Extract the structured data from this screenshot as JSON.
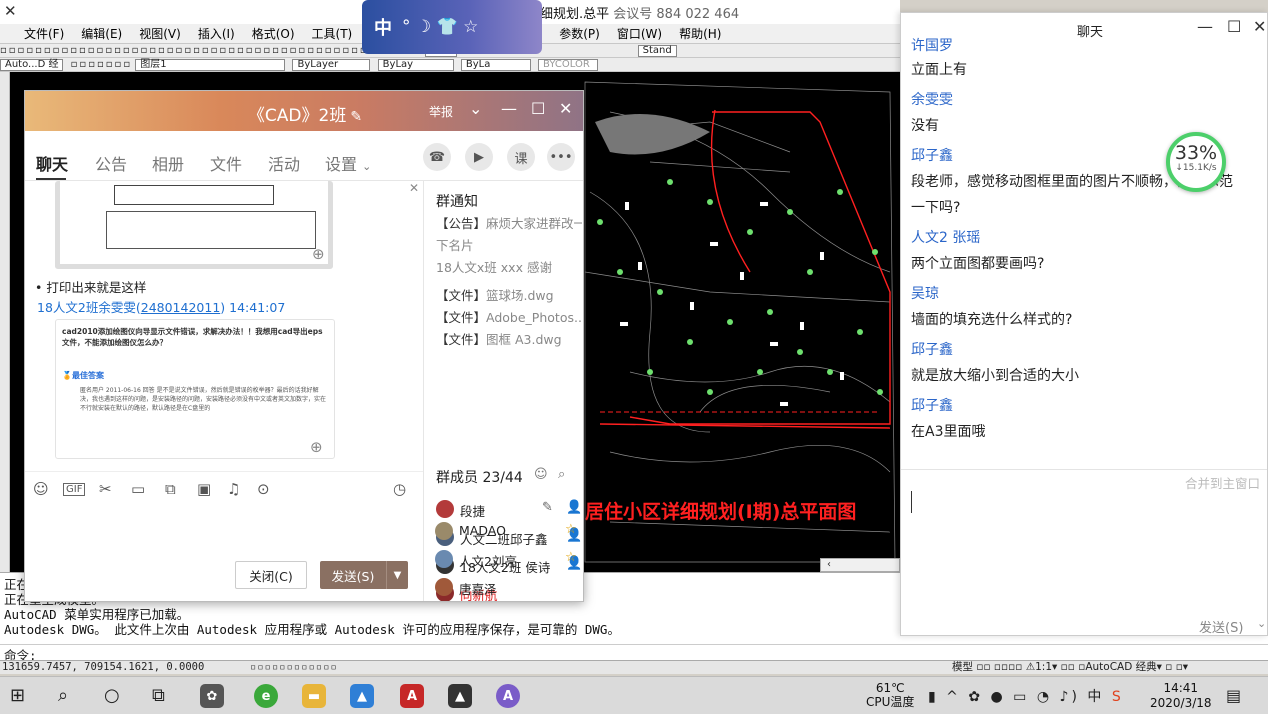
{
  "acad": {
    "title_text": "细规划.总平",
    "meeting_text": "会议号 884 022 464",
    "menu": [
      "文件(F)",
      "编辑(E)",
      "视图(V)",
      "插入(I)",
      "格式(O)",
      "工具(T)"
    ],
    "menu_right": [
      "参数(P)",
      "窗口(W)",
      "帮助(H)"
    ],
    "toolbar1_text": "Stan",
    "toolbar1_style": "Stand",
    "toolbar2_font": "Auto...D 经",
    "toolbar2_layer": "图层1",
    "toolbar2_bylayer": "ByLayer",
    "toolbar2_bylay1": "ByLay",
    "toolbar2_bylay2": "ByLa",
    "toolbar2_bycolor": "BYCOLOR",
    "plan_title": "居住小区详细规划(I期)总平面图",
    "command_lines": [
      "正在",
      "正在重生成模型。",
      "AutoCAD 菜单实用程序已加载。",
      "Autodesk DWG。  此文件上次由 Autodesk 应用程序或 Autodesk 许可的应用程序保存，是可靠的 DWG。"
    ],
    "command_prompt": "命令:",
    "coords": "131659.7457, 709154.1621, 0.0000",
    "status_right": "模型  ▫▫   ▫▫▫▫   ⚠1:1▾ ▫▫ ▫AutoCAD 经典▾ ▫ ▫▾"
  },
  "ime": {
    "lang": "中",
    "symbols": "° ☽ 👕 ☆"
  },
  "group_window": {
    "title": "《CAD》2班",
    "report": "举报",
    "tabs": [
      "聊天",
      "公告",
      "相册",
      "文件",
      "活动",
      "设置"
    ],
    "round_buttons": [
      "☎",
      "▶",
      "课",
      "•••"
    ],
    "messages": {
      "text1": "• 打印出来就是这样",
      "sender2_name": "18人文2班余雯雯",
      "sender2_qq": "2480142011",
      "sender2_time": "14:41:07",
      "img2_question": "cad2010添加绘图仪向导显示文件错误，求解决办法！！我想用cad导出eps文件，不能添加绘图仪怎么办？",
      "img2_best": "最佳答案",
      "img2_answer": "匿名用户 2011-06-16 回答 是不是说文件错误，然后就是错误的枚举器？最后的话我好解决，我也遇到这样的问题，是安装路径的问题，安装路径必须没有中文或者英文加数字，实在不行就安装在默认的路径，默认路径是在C盘里的"
    },
    "close_label": "关闭(C)",
    "send_label": "发送(S)",
    "notice": {
      "title": "群通知",
      "announcement_tag": "【公告】",
      "announcement": "麻烦大家进群改一下名片",
      "announcement_line2": "下名片",
      "announcement_line3": "18人文x班 xxx 感谢",
      "files": [
        {
          "tag": "【文件】",
          "name": "篮球场.dwg"
        },
        {
          "tag": "【文件】",
          "name": "Adobe_Photos..."
        },
        {
          "tag": "【文件】",
          "name": "图框 A3.dwg"
        }
      ]
    },
    "members_title": "群成员 23/44",
    "members": [
      {
        "name": "段捷",
        "role_icon": "👤",
        "color": "#222222"
      },
      {
        "name": "人文二班邱子鑫",
        "role_icon": "👤",
        "color": "#222222"
      },
      {
        "name": "18人文2班 侯诗",
        "role_icon": "👤",
        "color": "#222222"
      },
      {
        "name": "向新航",
        "role_icon": "",
        "color": "#e02020"
      },
      {
        "name": "MADAO",
        "role_icon": "☆",
        "color": "#222222"
      },
      {
        "name": "人文2刘亮",
        "role_icon": "☆",
        "color": "#222222"
      },
      {
        "name": "唐嘉泽",
        "role_icon": "",
        "color": "#222222"
      }
    ]
  },
  "chat_window": {
    "title": "聊天",
    "lines": [
      {
        "kind": "name",
        "text": "许国罗"
      },
      {
        "kind": "text",
        "text": "立面上有"
      },
      {
        "kind": "name",
        "text": "余雯雯"
      },
      {
        "kind": "text",
        "text": "没有"
      },
      {
        "kind": "name",
        "text": "邱子鑫"
      },
      {
        "kind": "text",
        "text": "段老师，感觉移动图框里面的图片不顺畅，能再示范"
      },
      {
        "kind": "text",
        "text": "一下吗?"
      },
      {
        "kind": "name",
        "text": "人文2 张瑶"
      },
      {
        "kind": "text",
        "text": "两个立面图都要画吗?"
      },
      {
        "kind": "name",
        "text": "吴琼"
      },
      {
        "kind": "text",
        "text": "墙面的填充选什么样式的?"
      },
      {
        "kind": "name",
        "text": "邱子鑫"
      },
      {
        "kind": "text",
        "text": "就是放大缩小到合适的大小"
      },
      {
        "kind": "name",
        "text": "邱子鑫"
      },
      {
        "kind": "text",
        "text": "在A3里面哦"
      }
    ],
    "merge_label": "合并到主窗口",
    "send_label": "发送(S)"
  },
  "speed_widget": {
    "percent": "33%",
    "rate": "↓15.1K/s"
  },
  "taskbar": {
    "cpu_temp": "61℃",
    "cpu_label": "CPU温度",
    "ime": "中",
    "time": "14:41",
    "date": "2020/3/18"
  }
}
